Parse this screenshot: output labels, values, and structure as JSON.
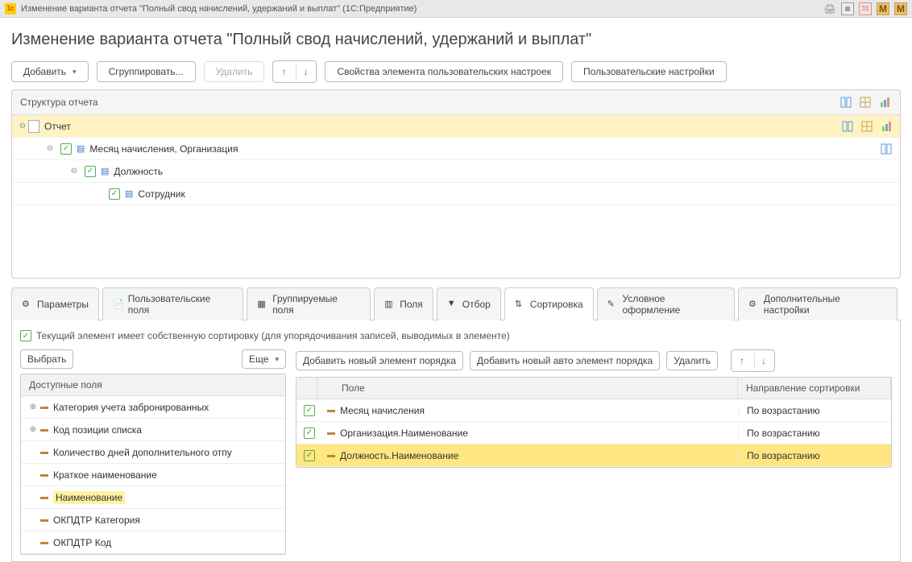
{
  "titlebar": {
    "text": "Изменение варианта отчета \"Полный свод начислений, удержаний и выплат\"  (1С:Предприятие)"
  },
  "page": {
    "heading": "Изменение варианта отчета \"Полный свод начислений, удержаний и выплат\""
  },
  "toolbar": {
    "add": "Добавить",
    "group": "Сгруппировать...",
    "delete": "Удалить",
    "custom_props": "Свойства элемента пользовательских настроек",
    "user_settings": "Пользовательские настройки"
  },
  "structure": {
    "header": "Структура отчета",
    "rows": {
      "root": "Отчет",
      "n1": "Месяц начисления, Организация",
      "n2": "Должность",
      "n3": "Сотрудник"
    }
  },
  "tabs": {
    "parameters": "Параметры",
    "user_fields": "Пользовательские поля",
    "group_fields": "Группируемые поля",
    "fields": "Поля",
    "filter": "Отбор",
    "sort": "Сортировка",
    "cond_format": "Условное оформление",
    "extra": "Дополнительные настройки"
  },
  "sort": {
    "info": "Текущий элемент имеет собственную сортировку (для  упорядочивания записей, выводимых в элементе)",
    "left_toolbar": {
      "choose": "Выбрать",
      "more": "Еще"
    },
    "right_toolbar": {
      "add_elem": "Добавить новый элемент порядка",
      "add_auto": "Добавить новый авто элемент порядка",
      "delete": "Удалить"
    },
    "left_header": "Доступные поля",
    "left_items": [
      {
        "expandable": true,
        "label": "Категория учета забронированных"
      },
      {
        "expandable": true,
        "label": "Код позиции списка"
      },
      {
        "expandable": false,
        "label": "Количество дней дополнительного отпу"
      },
      {
        "expandable": false,
        "label": "Краткое наименование"
      },
      {
        "expandable": false,
        "label": "Наименование",
        "highlight": true
      },
      {
        "expandable": false,
        "label": "ОКПДТР Категория"
      },
      {
        "expandable": false,
        "label": "ОКПДТР Код"
      }
    ],
    "right_headers": {
      "field": "Поле",
      "direction": "Направление сортировки"
    },
    "rows": [
      {
        "field": "Месяц начисления",
        "dir": "По возрастанию",
        "sel": false
      },
      {
        "field": "Организация.Наименование",
        "dir": "По возрастанию",
        "sel": false
      },
      {
        "field": "Должность.Наименование",
        "dir": "По возрастанию",
        "sel": true
      }
    ]
  }
}
